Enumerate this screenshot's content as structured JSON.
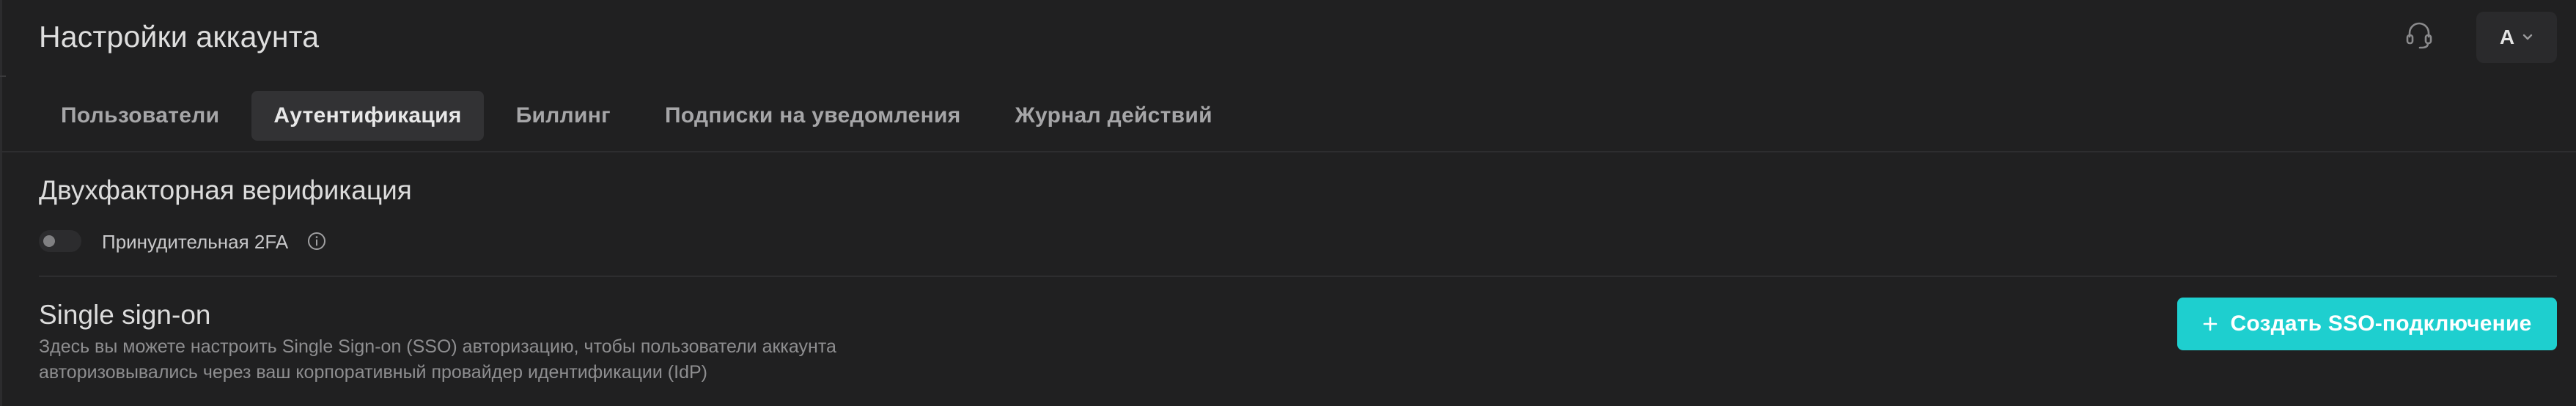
{
  "header": {
    "title": "Настройки аккаунта",
    "account_initial": "A",
    "support_icon": "headset-icon",
    "account_chevron_icon": "chevron-down-icon"
  },
  "tabs": [
    {
      "label": "Пользователи",
      "active": false
    },
    {
      "label": "Аутентификация",
      "active": true
    },
    {
      "label": "Биллинг",
      "active": false
    },
    {
      "label": "Подписки на уведомления",
      "active": false
    },
    {
      "label": "Журнал действий",
      "active": false
    }
  ],
  "two_factor": {
    "title": "Двухфакторная верификация",
    "toggle_label": "Принудительная 2FA",
    "toggle_on": false,
    "info_icon": "info-icon"
  },
  "sso": {
    "title": "Single sign-on",
    "description_line1": "Здесь вы можете настроить Single Sign-on (SSO) авторизацию, чтобы пользователи аккаунта",
    "description_line2": "авторизовывались через ваш корпоративный провайдер идентификации (IdP)",
    "button_label": "Создать SSO-подключение",
    "button_icon": "plus-icon"
  },
  "colors": {
    "background": "#202021",
    "accent": "#1ecfcf",
    "active_tab_bg": "#323234",
    "muted_text": "#8e8e90"
  }
}
